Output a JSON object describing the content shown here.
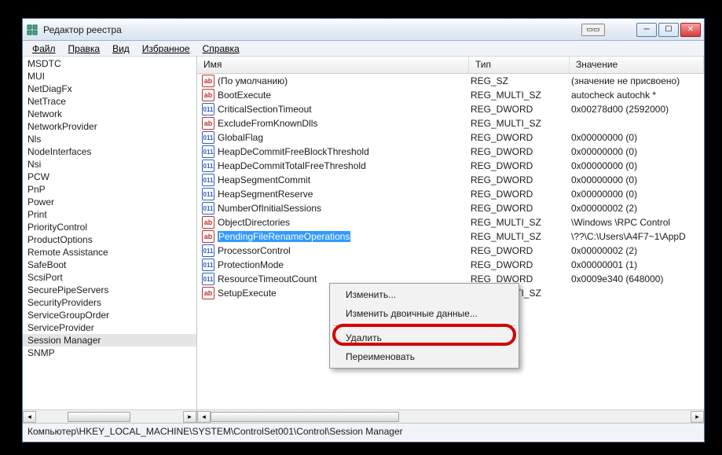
{
  "window": {
    "title": "Редактор реестра"
  },
  "menu": {
    "file": "Файл",
    "edit": "Правка",
    "view": "Вид",
    "favorites": "Избранное",
    "help": "Справка"
  },
  "tree": {
    "items": [
      "MSDTC",
      "MUI",
      "NetDiagFx",
      "NetTrace",
      "Network",
      "NetworkProvider",
      "Nls",
      "NodeInterfaces",
      "Nsi",
      "PCW",
      "PnP",
      "Power",
      "Print",
      "PriorityControl",
      "ProductOptions",
      "Remote Assistance",
      "SafeBoot",
      "ScsiPort",
      "SecurePipeServers",
      "SecurityProviders",
      "ServiceGroupOrder",
      "ServiceProvider",
      "Session Manager",
      "SNMP"
    ],
    "selected_index": 22
  },
  "columns": {
    "name": "Имя",
    "type": "Тип",
    "value": "Значение"
  },
  "rows": [
    {
      "icon": "ab",
      "name": "(По умолчанию)",
      "type": "REG_SZ",
      "value": "(значение не присвоено)"
    },
    {
      "icon": "ab",
      "name": "BootExecute",
      "type": "REG_MULTI_SZ",
      "value": "autocheck autochk *"
    },
    {
      "icon": "bin",
      "name": "CriticalSectionTimeout",
      "type": "REG_DWORD",
      "value": "0x00278d00 (2592000)"
    },
    {
      "icon": "ab",
      "name": "ExcludeFromKnownDlls",
      "type": "REG_MULTI_SZ",
      "value": ""
    },
    {
      "icon": "bin",
      "name": "GlobalFlag",
      "type": "REG_DWORD",
      "value": "0x00000000 (0)"
    },
    {
      "icon": "bin",
      "name": "HeapDeCommitFreeBlockThreshold",
      "type": "REG_DWORD",
      "value": "0x00000000 (0)"
    },
    {
      "icon": "bin",
      "name": "HeapDeCommitTotalFreeThreshold",
      "type": "REG_DWORD",
      "value": "0x00000000 (0)"
    },
    {
      "icon": "bin",
      "name": "HeapSegmentCommit",
      "type": "REG_DWORD",
      "value": "0x00000000 (0)"
    },
    {
      "icon": "bin",
      "name": "HeapSegmentReserve",
      "type": "REG_DWORD",
      "value": "0x00000000 (0)"
    },
    {
      "icon": "bin",
      "name": "NumberOfInitialSessions",
      "type": "REG_DWORD",
      "value": "0x00000002 (2)"
    },
    {
      "icon": "ab",
      "name": "ObjectDirectories",
      "type": "REG_MULTI_SZ",
      "value": "\\Windows \\RPC Control"
    },
    {
      "icon": "ab",
      "name": "PendingFileRenameOperations",
      "type": "REG_MULTI_SZ",
      "value": "\\??\\C:\\Users\\A4F7~1\\AppD",
      "selected": true
    },
    {
      "icon": "bin",
      "name": "ProcessorControl",
      "type": "REG_DWORD",
      "value": "0x00000002 (2)"
    },
    {
      "icon": "bin",
      "name": "ProtectionMode",
      "type": "REG_DWORD",
      "value": "0x00000001 (1)"
    },
    {
      "icon": "bin",
      "name": "ResourceTimeoutCount",
      "type": "REG_DWORD",
      "value": "0x0009e340 (648000)"
    },
    {
      "icon": "ab",
      "name": "SetupExecute",
      "type": "REG_MULTI_SZ",
      "value": ""
    }
  ],
  "context_menu": {
    "modify": "Изменить...",
    "modify_binary": "Изменить двоичные данные...",
    "delete": "Удалить",
    "rename": "Переименовать"
  },
  "statusbar": "Компьютер\\HKEY_LOCAL_MACHINE\\SYSTEM\\ControlSet001\\Control\\Session Manager",
  "icons": {
    "ab_label": "ab",
    "bin_label": "011"
  },
  "window_buttons": {
    "min": "─",
    "max": "☐",
    "close": "✕"
  }
}
